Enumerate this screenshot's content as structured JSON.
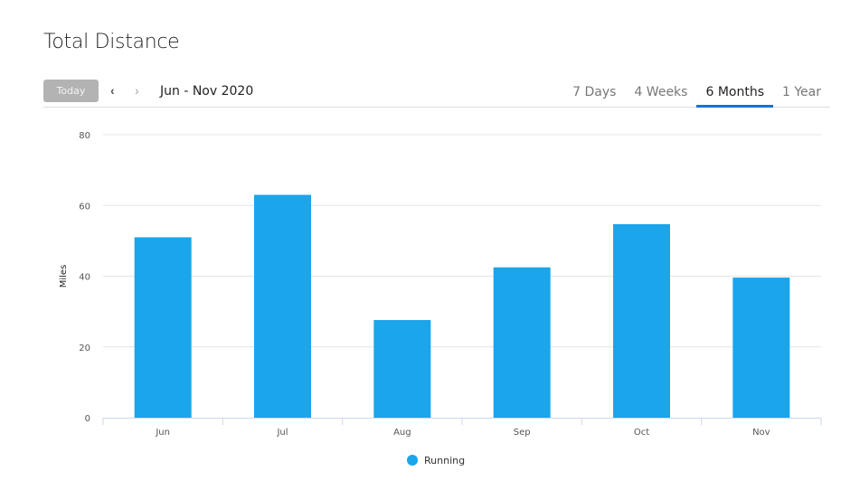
{
  "header": {
    "title": "Total Distance"
  },
  "toolbar": {
    "today_label": "Today",
    "prev_icon": "chevron-left-icon",
    "next_icon": "chevron-right-icon",
    "date_range": "Jun - Nov 2020",
    "tabs": [
      {
        "label": "7 Days",
        "active": false
      },
      {
        "label": "4 Weeks",
        "active": false
      },
      {
        "label": "6 Months",
        "active": true
      },
      {
        "label": "1 Year",
        "active": false
      }
    ],
    "accent_color": "#1a73c8"
  },
  "chart_data": {
    "type": "bar",
    "title": "Total Distance",
    "xlabel": "",
    "ylabel": "Miles",
    "categories": [
      "Jun",
      "Jul",
      "Aug",
      "Sep",
      "Oct",
      "Nov"
    ],
    "series": [
      {
        "name": "Running",
        "color": "#1ba5eb",
        "values": [
          51,
          63,
          27.6,
          42.5,
          54.7,
          39.6
        ]
      }
    ],
    "ylim": [
      0,
      80
    ],
    "yticks": [
      0,
      20,
      40,
      60,
      80
    ],
    "grid": true,
    "legend": "bottom-center"
  }
}
